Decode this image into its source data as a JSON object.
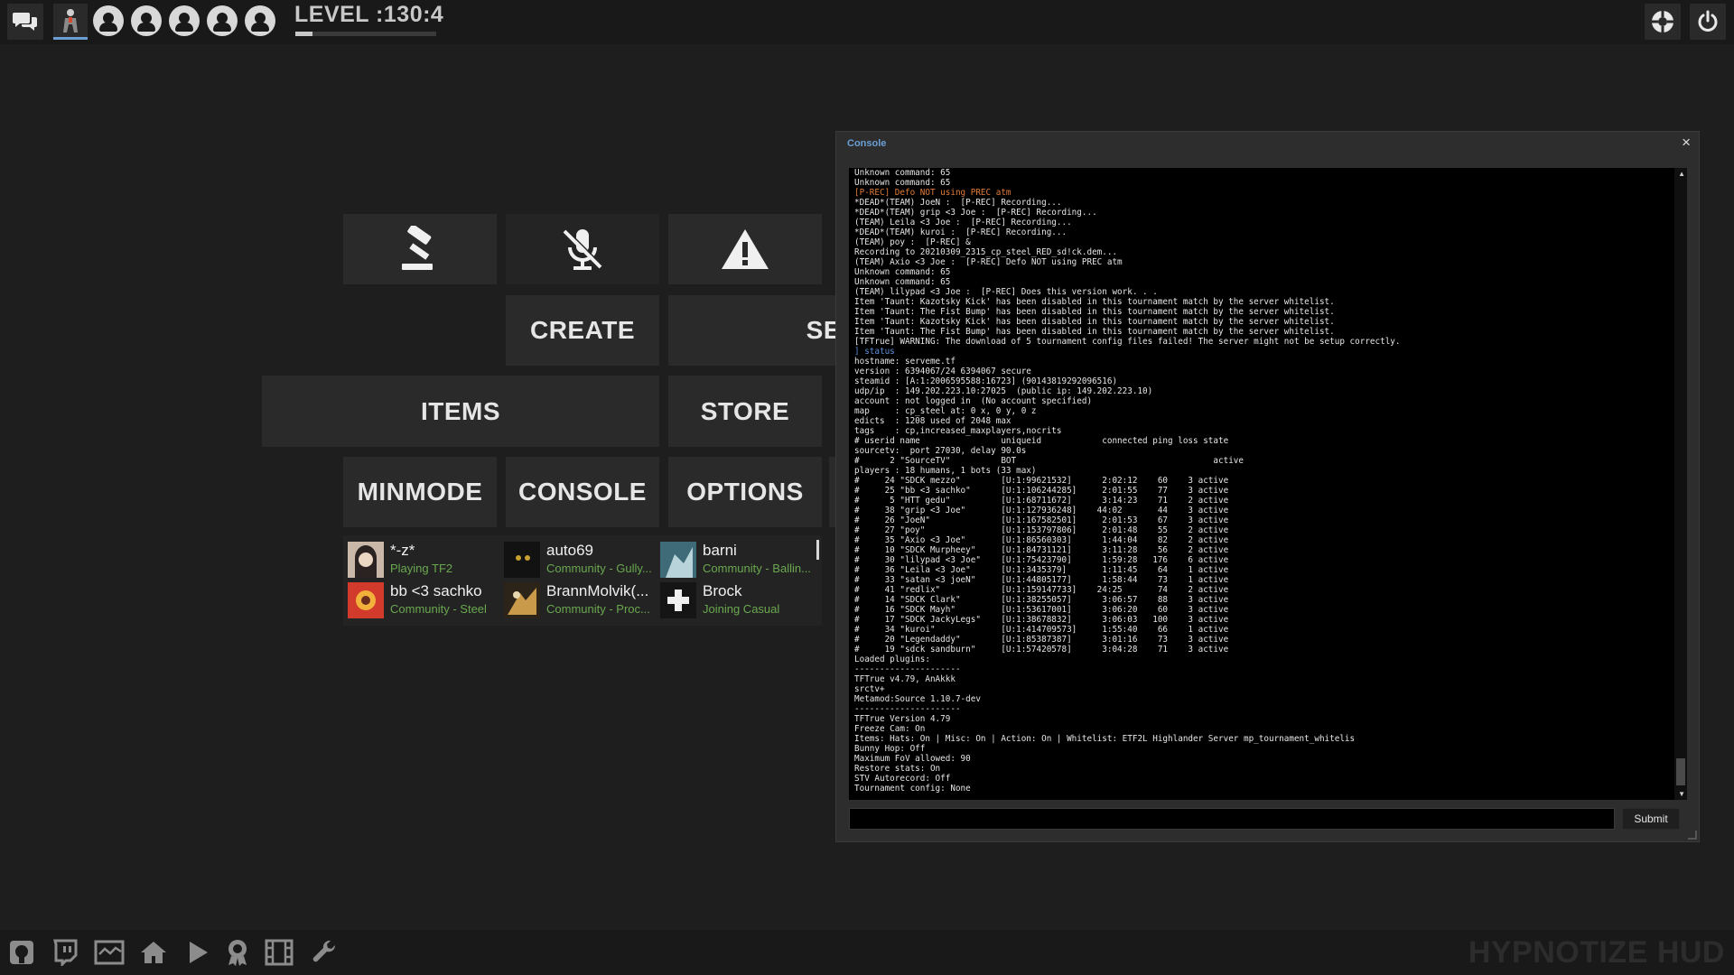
{
  "topbar": {
    "level_text": "LEVEL :130:4",
    "level_progress": 0.12,
    "party_slots": 5
  },
  "menu": {
    "create_label": "CREATE",
    "server_label": "SE",
    "items_label": "ITEMS",
    "store_label": "STORE",
    "minmode_label": "MINMODE",
    "console_label": "CONSOLE",
    "options_label": "OPTIONS"
  },
  "friends": [
    {
      "name": "*-z*",
      "status": "Playing TF2"
    },
    {
      "name": "auto69",
      "status": "Community - Gully..."
    },
    {
      "name": "barni",
      "status": "Community - Ballin..."
    },
    {
      "name": "bb <3 sachko",
      "status": "Community - Steel"
    },
    {
      "name": "BrannMolvik(...",
      "status": "Community - Proc..."
    },
    {
      "name": "Brock",
      "status": "Joining Casual"
    }
  ],
  "console": {
    "title": "Console",
    "close": "×",
    "submit_label": "Submit",
    "input_value": "",
    "lines": [
      {
        "t": "Unknown command: 65",
        "c": ""
      },
      {
        "t": "Unknown command: 65",
        "c": ""
      },
      {
        "t": "[P-REC] Defo NOT using PREC atm",
        "c": "prec"
      },
      {
        "t": "*DEAD*(TEAM) JoeN :  [P-REC] Recording...",
        "c": ""
      },
      {
        "t": "*DEAD*(TEAM) grip <3 Joe :  [P-REC] Recording...",
        "c": ""
      },
      {
        "t": "(TEAM) Leila <3 Joe :  [P-REC] Recording...",
        "c": ""
      },
      {
        "t": "*DEAD*(TEAM) kuroi :  [P-REC] Recording...",
        "c": ""
      },
      {
        "t": "(TEAM) poy :  [P-REC] &",
        "c": ""
      },
      {
        "t": "Recording to 20210309_2315_cp_steel_RED_sd!ck.dem...",
        "c": ""
      },
      {
        "t": "(TEAM) Axio <3 Joe :  [P-REC] Defo NOT using PREC atm",
        "c": ""
      },
      {
        "t": "Unknown command: 65",
        "c": ""
      },
      {
        "t": "Unknown command: 65",
        "c": ""
      },
      {
        "t": "(TEAM) lilypad <3 Joe :  [P-REC] Does this version work. . .",
        "c": ""
      },
      {
        "t": "Item 'Taunt: Kazotsky Kick' has been disabled in this tournament match by the server whitelist.",
        "c": ""
      },
      {
        "t": "Item 'Taunt: The Fist Bump' has been disabled in this tournament match by the server whitelist.",
        "c": ""
      },
      {
        "t": "Item 'Taunt: Kazotsky Kick' has been disabled in this tournament match by the server whitelist.",
        "c": ""
      },
      {
        "t": "Item 'Taunt: The Fist Bump' has been disabled in this tournament match by the server whitelist.",
        "c": ""
      },
      {
        "t": "[TFTrue] WARNING: The download of 5 tournament config files failed! The server might not be setup correctly.",
        "c": ""
      },
      {
        "t": "] status",
        "c": "cmd"
      },
      {
        "t": "hostname: serveme.tf",
        "c": ""
      },
      {
        "t": "version : 6394067/24 6394067 secure",
        "c": ""
      },
      {
        "t": "steamid : [A:1:2006595588:16723] (90143819292096516)",
        "c": ""
      },
      {
        "t": "udp/ip  : 149.202.223.10:27025  (public ip: 149.202.223.10)",
        "c": ""
      },
      {
        "t": "account : not logged in  (No account specified)",
        "c": ""
      },
      {
        "t": "map     : cp_steel at: 0 x, 0 y, 0 z",
        "c": ""
      },
      {
        "t": "edicts  : 1208 used of 2048 max",
        "c": ""
      },
      {
        "t": "tags    : cp,increased_maxplayers,nocrits",
        "c": ""
      },
      {
        "t": "# userid name                uniqueid            connected ping loss state",
        "c": ""
      },
      {
        "t": "sourcetv:  port 27030, delay 90.0s",
        "c": ""
      },
      {
        "t": "#      2 \"SourceTV\"          BOT                                       active",
        "c": ""
      },
      {
        "t": "players : 18 humans, 1 bots (33 max)",
        "c": ""
      },
      {
        "t": "#     24 \"SDCK mezzo\"        [U:1:99621532]      2:02:12    60    3 active",
        "c": ""
      },
      {
        "t": "#     25 \"bb <3 sachko\"      [U:1:106244285]     2:01:55    77    3 active",
        "c": ""
      },
      {
        "t": "#      5 \"HTT gedu\"          [U:1:68711672]      3:14:23    71    2 active",
        "c": ""
      },
      {
        "t": "#     38 \"grip <3 Joe\"       [U:1:127936248]    44:02       44    3 active",
        "c": ""
      },
      {
        "t": "#     26 \"JoeN\"              [U:1:167582501]     2:01:53    67    3 active",
        "c": ""
      },
      {
        "t": "#     27 \"poy\"               [U:1:153797806]     2:01:48    55    2 active",
        "c": ""
      },
      {
        "t": "#     35 \"Axio <3 Joe\"       [U:1:86560303]      1:44:04    82    2 active",
        "c": ""
      },
      {
        "t": "#     10 \"SDCK Murpheey\"     [U:1:84731121]      3:11:28    56    2 active",
        "c": ""
      },
      {
        "t": "#     30 \"lilypad <3 Joe\"    [U:1:75423790]      1:59:28   176    6 active",
        "c": ""
      },
      {
        "t": "#     36 \"Leila <3 Joe\"      [U:1:3435379]       1:11:45    64    1 active",
        "c": ""
      },
      {
        "t": "#     33 \"satan <3 joeN\"     [U:1:44805177]      1:58:44    73    1 active",
        "c": ""
      },
      {
        "t": "#     41 \"redlix\"            [U:1:159147733]    24:25       74    2 active",
        "c": ""
      },
      {
        "t": "#     14 \"SDCK Clark\"        [U:1:38255057]      3:06:57    88    3 active",
        "c": ""
      },
      {
        "t": "#     16 \"SDCK Mayh\"         [U:1:53617001]      3:06:20    60    3 active",
        "c": ""
      },
      {
        "t": "#     17 \"SDCK JackyLegs\"    [U:1:38678832]      3:06:03   100    3 active",
        "c": ""
      },
      {
        "t": "#     34 \"kuroi\"             [U:1:414709573]     1:55:40    66    1 active",
        "c": ""
      },
      {
        "t": "#     20 \"Legendaddy\"        [U:1:85387387]      3:01:16    73    3 active",
        "c": ""
      },
      {
        "t": "#     19 \"sdck sandburn\"     [U:1:57420578]      3:04:28    71    3 active",
        "c": ""
      },
      {
        "t": "Loaded plugins:",
        "c": ""
      },
      {
        "t": "---------------------",
        "c": ""
      },
      {
        "t": "TFTrue v4.79, AnAkkk",
        "c": ""
      },
      {
        "t": "srctv+",
        "c": ""
      },
      {
        "t": "Metamod:Source 1.10.7-dev",
        "c": ""
      },
      {
        "t": "---------------------",
        "c": ""
      },
      {
        "t": "TFTrue Version 4.79",
        "c": ""
      },
      {
        "t": "Freeze Cam: On",
        "c": ""
      },
      {
        "t": "Items: Hats: On | Misc: On | Action: On | Whitelist: ETF2L Highlander Server mp_tournament_whitelis",
        "c": ""
      },
      {
        "t": "Bunny Hop: Off",
        "c": ""
      },
      {
        "t": "Maximum FoV allowed: 90",
        "c": ""
      },
      {
        "t": "Restore stats: On",
        "c": ""
      },
      {
        "t": "STV Autorecord: Off",
        "c": ""
      },
      {
        "t": "Tournament config: None",
        "c": ""
      }
    ]
  },
  "bottombar": {
    "brand": "HYPNOTIZE HUD"
  },
  "colors": {
    "background": "#1e1e1e",
    "tile": "#2a2a2a",
    "friend_status": "#6aa84f",
    "prec_line": "#e07b39",
    "command_line": "#5b8fd6"
  }
}
